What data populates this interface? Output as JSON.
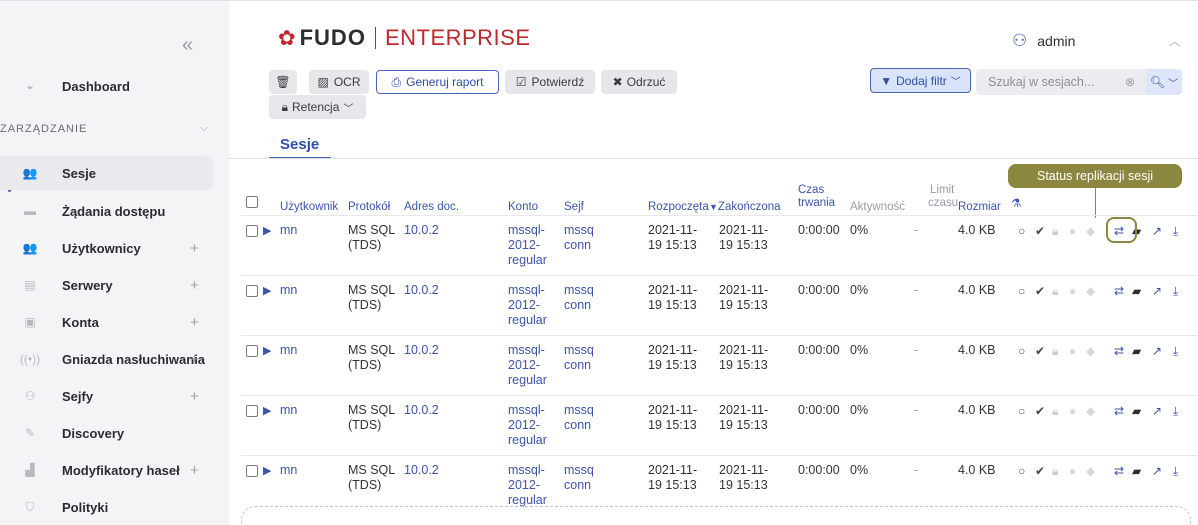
{
  "sidebar": {
    "collapse_icon": "«",
    "dashboard": "Dashboard",
    "section": "ZARZĄDZANIE",
    "items": [
      {
        "label": "Sesje",
        "icon": "sessions-icon",
        "glyph": "👥",
        "plus": ""
      },
      {
        "label": "Żądania dostępu",
        "icon": "access-requests-icon",
        "glyph": "▬",
        "plus": ""
      },
      {
        "label": "Użytkownicy",
        "icon": "users-icon",
        "glyph": "👥",
        "plus": "+"
      },
      {
        "label": "Serwery",
        "icon": "servers-icon",
        "glyph": "▤",
        "plus": "+"
      },
      {
        "label": "Konta",
        "icon": "accounts-icon",
        "glyph": "▣",
        "plus": "+"
      },
      {
        "label": "Gniazda nasłuchiwania",
        "icon": "listeners-icon",
        "glyph": "((•))",
        "plus": "+"
      },
      {
        "label": "Sejfy",
        "icon": "safes-icon",
        "glyph": "⚇",
        "plus": "+"
      },
      {
        "label": "Discovery",
        "icon": "discovery-icon",
        "glyph": "✎",
        "plus": ""
      },
      {
        "label": "Modyfikatory haseł",
        "icon": "password-modifiers-icon",
        "glyph": "▟",
        "plus": "+"
      },
      {
        "label": "Polityki",
        "icon": "policies-icon",
        "glyph": "⛉",
        "plus": ""
      }
    ]
  },
  "header": {
    "brand": "FUDO",
    "edition": "ENTERPRISE",
    "user": "admin"
  },
  "toolbar": {
    "ocr": "OCR",
    "report": "Generuj raport",
    "confirm": "Potwierdź",
    "reject": "Odrzuć",
    "retention": "Retencja",
    "add_filter": "Dodaj filtr",
    "search_placeholder": "Szukaj w sesjach..."
  },
  "tab": "Sesje",
  "tooltip": "Status replikacji sesji",
  "table": {
    "headers": {
      "user": "Użytkownik",
      "protocol": "Protokół",
      "address": "Adres doc.",
      "account": "Konto",
      "safe": "Sejf",
      "started": "Rozpoczęta",
      "ended": "Zakończona",
      "duration_1": "Czas",
      "duration_2": "trwania",
      "activity": "Aktywność",
      "limit_1": "Limit",
      "limit_2": "czasu",
      "size": "Rozmiar"
    },
    "rows": [
      {
        "user": "mn",
        "protocol_1": "MS SQL",
        "protocol_2": "(TDS)",
        "address": "10.0.2",
        "account_1": "mssql-",
        "account_2": "2012-",
        "account_3": "regular",
        "safe_1": "mssq",
        "safe_2": "conn",
        "started_1": "2021-11-",
        "started_2": "19 15:13",
        "ended_1": "2021-11-",
        "ended_2": "19 15:13",
        "duration": "0:00:00",
        "activity": "0%",
        "limit": "-",
        "size": "4.0 KB"
      },
      {
        "user": "mn",
        "protocol_1": "MS SQL",
        "protocol_2": "(TDS)",
        "address": "10.0.2",
        "account_1": "mssql-",
        "account_2": "2012-",
        "account_3": "regular",
        "safe_1": "mssq",
        "safe_2": "conn",
        "started_1": "2021-11-",
        "started_2": "19 15:13",
        "ended_1": "2021-11-",
        "ended_2": "19 15:13",
        "duration": "0:00:00",
        "activity": "0%",
        "limit": "-",
        "size": "4.0 KB"
      },
      {
        "user": "mn",
        "protocol_1": "MS SQL",
        "protocol_2": "(TDS)",
        "address": "10.0.2",
        "account_1": "mssql-",
        "account_2": "2012-",
        "account_3": "regular",
        "safe_1": "mssq",
        "safe_2": "conn",
        "started_1": "2021-11-",
        "started_2": "19 15:13",
        "ended_1": "2021-11-",
        "ended_2": "19 15:13",
        "duration": "0:00:00",
        "activity": "0%",
        "limit": "-",
        "size": "4.0 KB"
      },
      {
        "user": "mn",
        "protocol_1": "MS SQL",
        "protocol_2": "(TDS)",
        "address": "10.0.2",
        "account_1": "mssql-",
        "account_2": "2012-",
        "account_3": "regular",
        "safe_1": "mssq",
        "safe_2": "conn",
        "started_1": "2021-11-",
        "started_2": "19 15:13",
        "ended_1": "2021-11-",
        "ended_2": "19 15:13",
        "duration": "0:00:00",
        "activity": "0%",
        "limit": "-",
        "size": "4.0 KB"
      },
      {
        "user": "mn",
        "protocol_1": "MS SQL",
        "protocol_2": "(TDS)",
        "address": "10.0.2",
        "account_1": "mssql-",
        "account_2": "2012-",
        "account_3": "regular",
        "safe_1": "mssq",
        "safe_2": "conn",
        "started_1": "2021-11-",
        "started_2": "19 15:13",
        "ended_1": "2021-11-",
        "ended_2": "19 15:13",
        "duration": "0:00:00",
        "activity": "0%",
        "limit": "-",
        "size": "4.0 KB"
      }
    ],
    "row_icons": [
      {
        "name": "status-circle-icon",
        "glyph": "○",
        "color": "#555555"
      },
      {
        "name": "confirmed-check-icon",
        "glyph": "✔",
        "color": "#444444"
      },
      {
        "name": "lock-icon",
        "glyph": "🔒︎",
        "color": "#cccccc"
      },
      {
        "name": "comment-icon",
        "glyph": "●",
        "color": "#d9d9d9"
      },
      {
        "name": "tag-icon",
        "glyph": "◆",
        "color": "#d9d9d9"
      },
      {
        "name": "replication-status-icon",
        "glyph": "⇄",
        "color": "#3b55a8"
      },
      {
        "name": "folder-icon",
        "glyph": "▰",
        "color": "#2b2b33"
      },
      {
        "name": "share-icon",
        "glyph": "↗",
        "color": "#3b55a8"
      },
      {
        "name": "download-icon",
        "glyph": "⤓",
        "color": "#3b55a8"
      }
    ]
  }
}
